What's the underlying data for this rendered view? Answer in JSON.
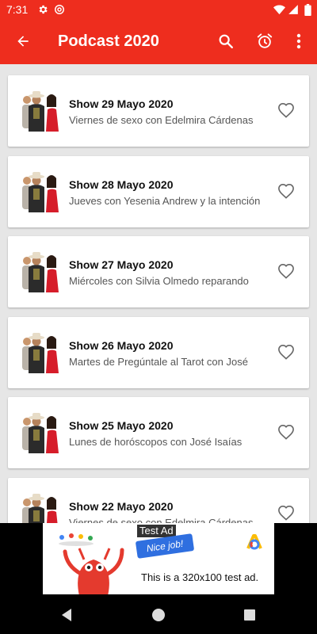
{
  "status_bar": {
    "time": "7:31",
    "icons": [
      "gear-icon",
      "at-sign-icon",
      "wifi-icon",
      "signal-icon",
      "battery-icon"
    ]
  },
  "app_bar": {
    "title": "Podcast 2020",
    "back_icon": "arrow-left-icon",
    "actions": [
      "search-icon",
      "alarm-clock-icon",
      "more-vert-icon"
    ],
    "color": "#ee2d1e"
  },
  "episodes": [
    {
      "title": "Show 29 Mayo 2020",
      "subtitle": "Viernes de sexo con Edelmira Cárdenas"
    },
    {
      "title": "Show 28 Mayo 2020",
      "subtitle": "Jueves con Yesenia Andrew y la intención"
    },
    {
      "title": "Show 27 Mayo 2020",
      "subtitle": "Miércoles con Silvia Olmedo reparando"
    },
    {
      "title": "Show 26 Mayo 2020",
      "subtitle": "Martes de Pregúntale al Tarot con José"
    },
    {
      "title": "Show 25 Mayo 2020",
      "subtitle": "Lunes de horóscopos con José Isaías"
    },
    {
      "title": "Show 22 Mayo 2020",
      "subtitle": "Viernes de sexo con Edelmira Cárdenas"
    }
  ],
  "ad": {
    "label": "Test Ad",
    "badge_text": "Nice job!",
    "text": "This is a 320x100 test ad."
  },
  "nav_bar": {
    "icons": [
      "back-triangle-icon",
      "home-circle-icon",
      "recents-square-icon"
    ]
  }
}
